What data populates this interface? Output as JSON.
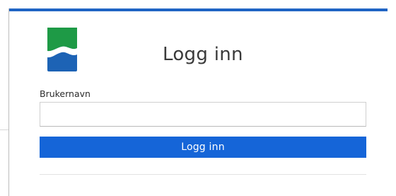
{
  "page": {
    "title": "Logg inn"
  },
  "form": {
    "username_label": "Brukernavn",
    "username_value": "",
    "username_placeholder": "",
    "submit_label": "Logg inn"
  },
  "logo": {
    "icon": "wave-logo-icon",
    "colors": {
      "top": "#1e9a46",
      "bottom": "#1d63b5",
      "wave": "#ffffff"
    }
  },
  "theme": {
    "accent": "#1565d8",
    "top_bar": "#1f64c4"
  }
}
